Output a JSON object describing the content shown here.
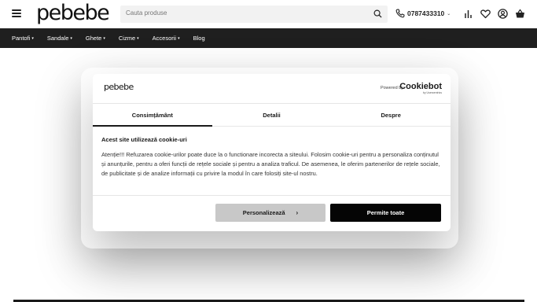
{
  "header": {
    "logo": "pebebe",
    "search_placeholder": "Cauta produse",
    "phone": "0787433310",
    "phone_chevron": "⌄"
  },
  "nav": {
    "items": [
      {
        "label": "Pantofi",
        "chevron": true
      },
      {
        "label": "Sandale",
        "chevron": true
      },
      {
        "label": "Ghete",
        "chevron": true
      },
      {
        "label": "Cizme",
        "chevron": true
      },
      {
        "label": "Accesorii",
        "chevron": true
      },
      {
        "label": "Blog",
        "chevron": false
      }
    ]
  },
  "dialog": {
    "logo": "pebebe",
    "powered_by": "Powered by",
    "cookiebot": "Cookiebot",
    "usercentrics": "by Usercentrics",
    "tabs": [
      {
        "label": "Consimțământ",
        "active": true
      },
      {
        "label": "Detalii",
        "active": false
      },
      {
        "label": "Despre",
        "active": false
      }
    ],
    "title": "Acest site utilizează cookie-uri",
    "text": "Atenție!!! Refuzarea cookie-urilor poate duce la o functionare incorecta a siteului. Folosim cookie-uri pentru a personaliza conținutul și anunțurile, pentru a oferi funcții de rețele sociale și pentru a analiza traficul. De asemenea, le oferim partenerilor de rețele sociale, de publicitate și de analize informații cu privire la modul în care folosiți site-ul nostru.",
    "btn_customize": "Personalizează",
    "btn_allow": "Permite toate"
  },
  "colors": {
    "nav_bg": "#1f1f1f",
    "allow_bg": "#050505",
    "customize_bg": "#c8c8c8"
  }
}
